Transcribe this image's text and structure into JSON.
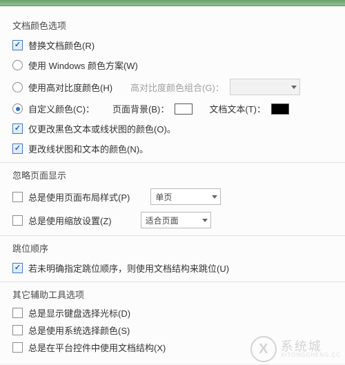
{
  "doc_color": {
    "title": "文档颜色选项",
    "replace": "替换文档颜色(R)",
    "use_windows": "使用 Windows 颜色方案(W)",
    "use_high_contrast": "使用高对比度颜色(H)",
    "hc_combo_label": "高对比度颜色组合(G)：",
    "custom": "自定义颜色(C)：",
    "page_bg_label": "页面背景(B)：",
    "doc_text_label": "文档文本(T)：",
    "only_black_text": "仅更改黑色文本或线状图的颜色(O)。",
    "change_line_text": "更改线状图和文本的颜色(N)。"
  },
  "override": {
    "title": "忽略页面显示",
    "always_layout": "总是使用页面布局样式(P)",
    "layout_value": "单页",
    "always_zoom": "总是使用缩放设置(Z)",
    "zoom_value": "适合页面"
  },
  "tab_order": {
    "title": "跳位顺序",
    "use_structure": "若未明确指定跳位顺序，则使用文档结构来跳位(U)"
  },
  "assist": {
    "title": "其它辅助工具选项",
    "show_caret": "总是显示键盘选择光标(D)",
    "use_sys_color": "总是使用系统选择颜色(S)",
    "platform_controls": "总是在平台控件中使用文档结构(X)"
  },
  "watermark": {
    "cn": "系统城",
    "en": "XITONGCHENG.CC"
  }
}
